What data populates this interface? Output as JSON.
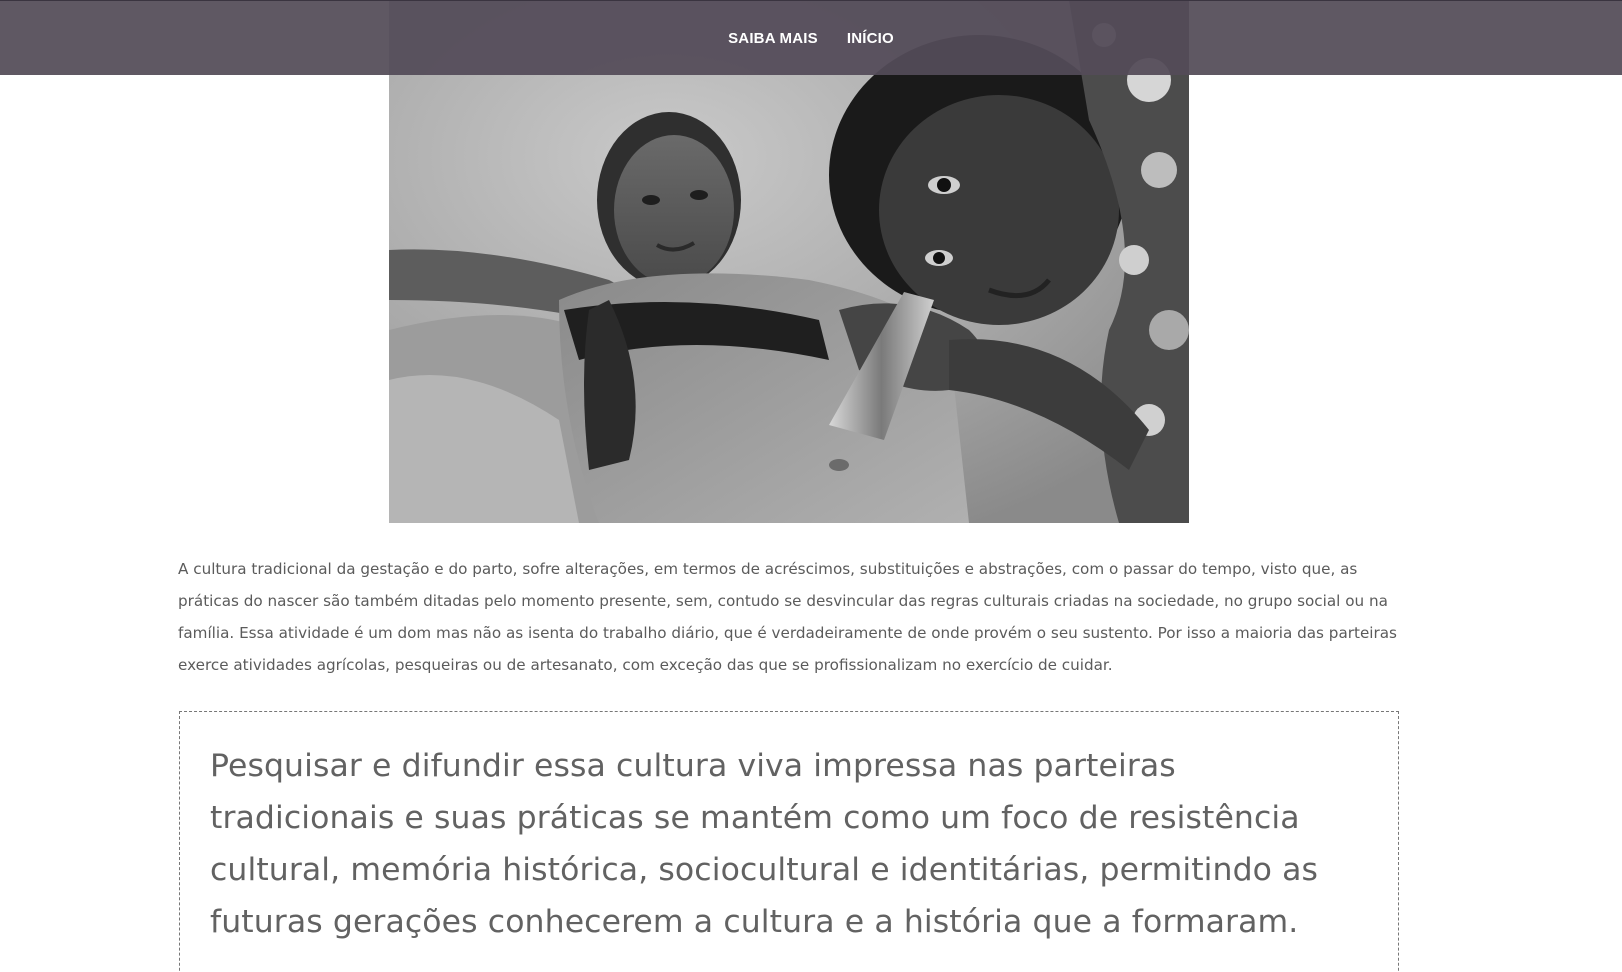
{
  "nav": {
    "items": [
      {
        "label": "SAIBA MAIS"
      },
      {
        "label": "INÍCIO"
      }
    ]
  },
  "hero": {
    "image_icon": "photo-midwife-listening-pregnant-belly-icon"
  },
  "intro": {
    "text": "A cultura tradicional da gestação e do parto, sofre alterações, em termos de acréscimos, substituições e abstrações, com o passar do tempo, visto que, as práticas do nascer são também ditadas pelo momento presente, sem, contudo se desvincular das regras culturais criadas na sociedade, no grupo social ou na família. Essa atividade é um dom mas não as isenta do trabalho diário, que é verdadeiramente de onde provém o seu sustento. Por isso a maioria das parteiras exerce atividades agrícolas, pesqueiras ou de artesanato, com exceção das que se profissionalizam no exercício de cuidar."
  },
  "quote": {
    "text": "Pesquisar e difundir essa cultura viva impressa nas parteiras tradicionais e suas práticas se mantém como um foco de resistência cultural, memória histórica, sociocultural e identitárias, permitindo as futuras gerações conhecerem a cultura e a história que a formaram."
  },
  "colors": {
    "nav_bar": "#4e4652",
    "nav_text": "#ffffff",
    "body_text": "#5b5b5b",
    "quote_text": "#626262",
    "quote_border": "#777777"
  }
}
